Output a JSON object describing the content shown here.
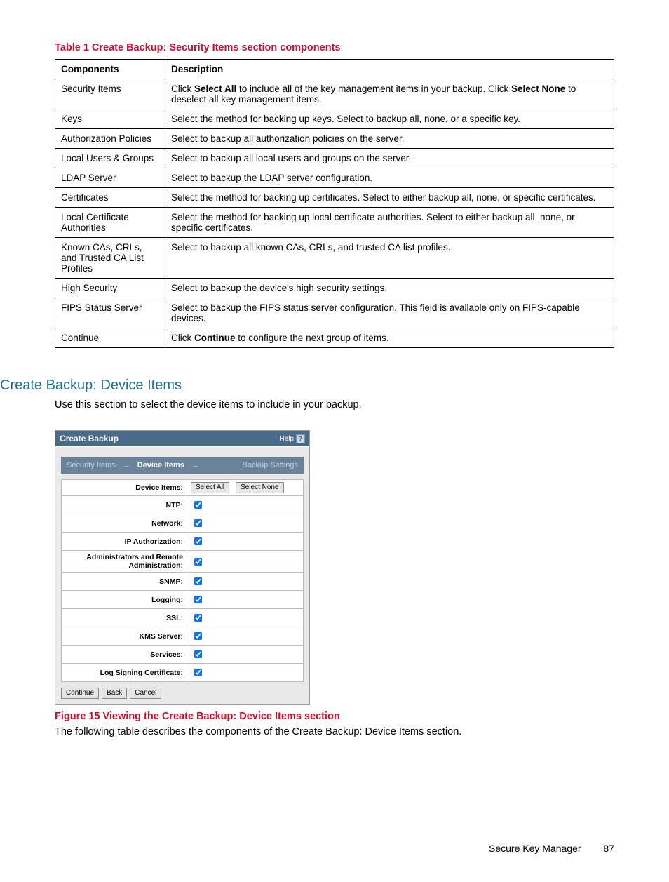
{
  "table1": {
    "title": "Table 1 Create Backup: Security Items section components",
    "headers": {
      "c": "Components",
      "d": "Description"
    },
    "rows": [
      {
        "c": "Security Items",
        "d_html": "Click <b>Select All</b> to include all of the key management items in your backup. Click <b>Select None</b> to deselect all key management items."
      },
      {
        "c": "Keys",
        "d_html": "Select the method for backing up keys. Select to backup all, none, or a specific key."
      },
      {
        "c": "Authorization Policies",
        "d_html": "Select to backup all authorization policies on the server."
      },
      {
        "c": "Local Users & Groups",
        "d_html": "Select to backup all local users and groups on the server."
      },
      {
        "c": "LDAP Server",
        "d_html": "Select to backup the LDAP server configuration."
      },
      {
        "c": "Certificates",
        "d_html": "Select the method for backing up certificates. Select to either backup all, none, or specific certificates."
      },
      {
        "c": "Local Certificate Authorities",
        "d_html": "Select the method for backing up local certificate authorities. Select to either backup all, none, or specific certificates."
      },
      {
        "c": "Known CAs, CRLs, and Trusted CA List Profiles",
        "d_html": "Select to backup all known CAs, CRLs, and trusted CA list profiles."
      },
      {
        "c": "High Security",
        "d_html": "Select to backup the device's high security settings."
      },
      {
        "c": "FIPS Status Server",
        "d_html": "Select to backup the FIPS status server configuration. This field is available only on FIPS-capable devices."
      },
      {
        "c": "Continue",
        "d_html": "Click <b>Continue</b> to configure the next group of items."
      }
    ]
  },
  "section": {
    "heading": "Create Backup: Device Items",
    "intro": "Use this section to select the device items to include in your backup."
  },
  "widget": {
    "title": "Create Backup",
    "help": "Help",
    "breadcrumb": {
      "a": "Security Items",
      "b": "Device Items",
      "c": "Backup Settings"
    },
    "device_items_label": "Device Items:",
    "select_all": "Select All",
    "select_none": "Select None",
    "rows": [
      "NTP:",
      "Network:",
      "IP Authorization:",
      "Administrators and Remote Administration:",
      "SNMP:",
      "Logging:",
      "SSL:",
      "KMS Server:",
      "Services:",
      "Log Signing Certificate:"
    ],
    "buttons": {
      "continue": "Continue",
      "back": "Back",
      "cancel": "Cancel"
    }
  },
  "figure": {
    "title": "Figure 15 Viewing the Create Backup: Device Items section",
    "after": "The following table describes the components of the Create Backup: Device Items section."
  },
  "footer": {
    "product": "Secure Key Manager",
    "page": "87"
  }
}
